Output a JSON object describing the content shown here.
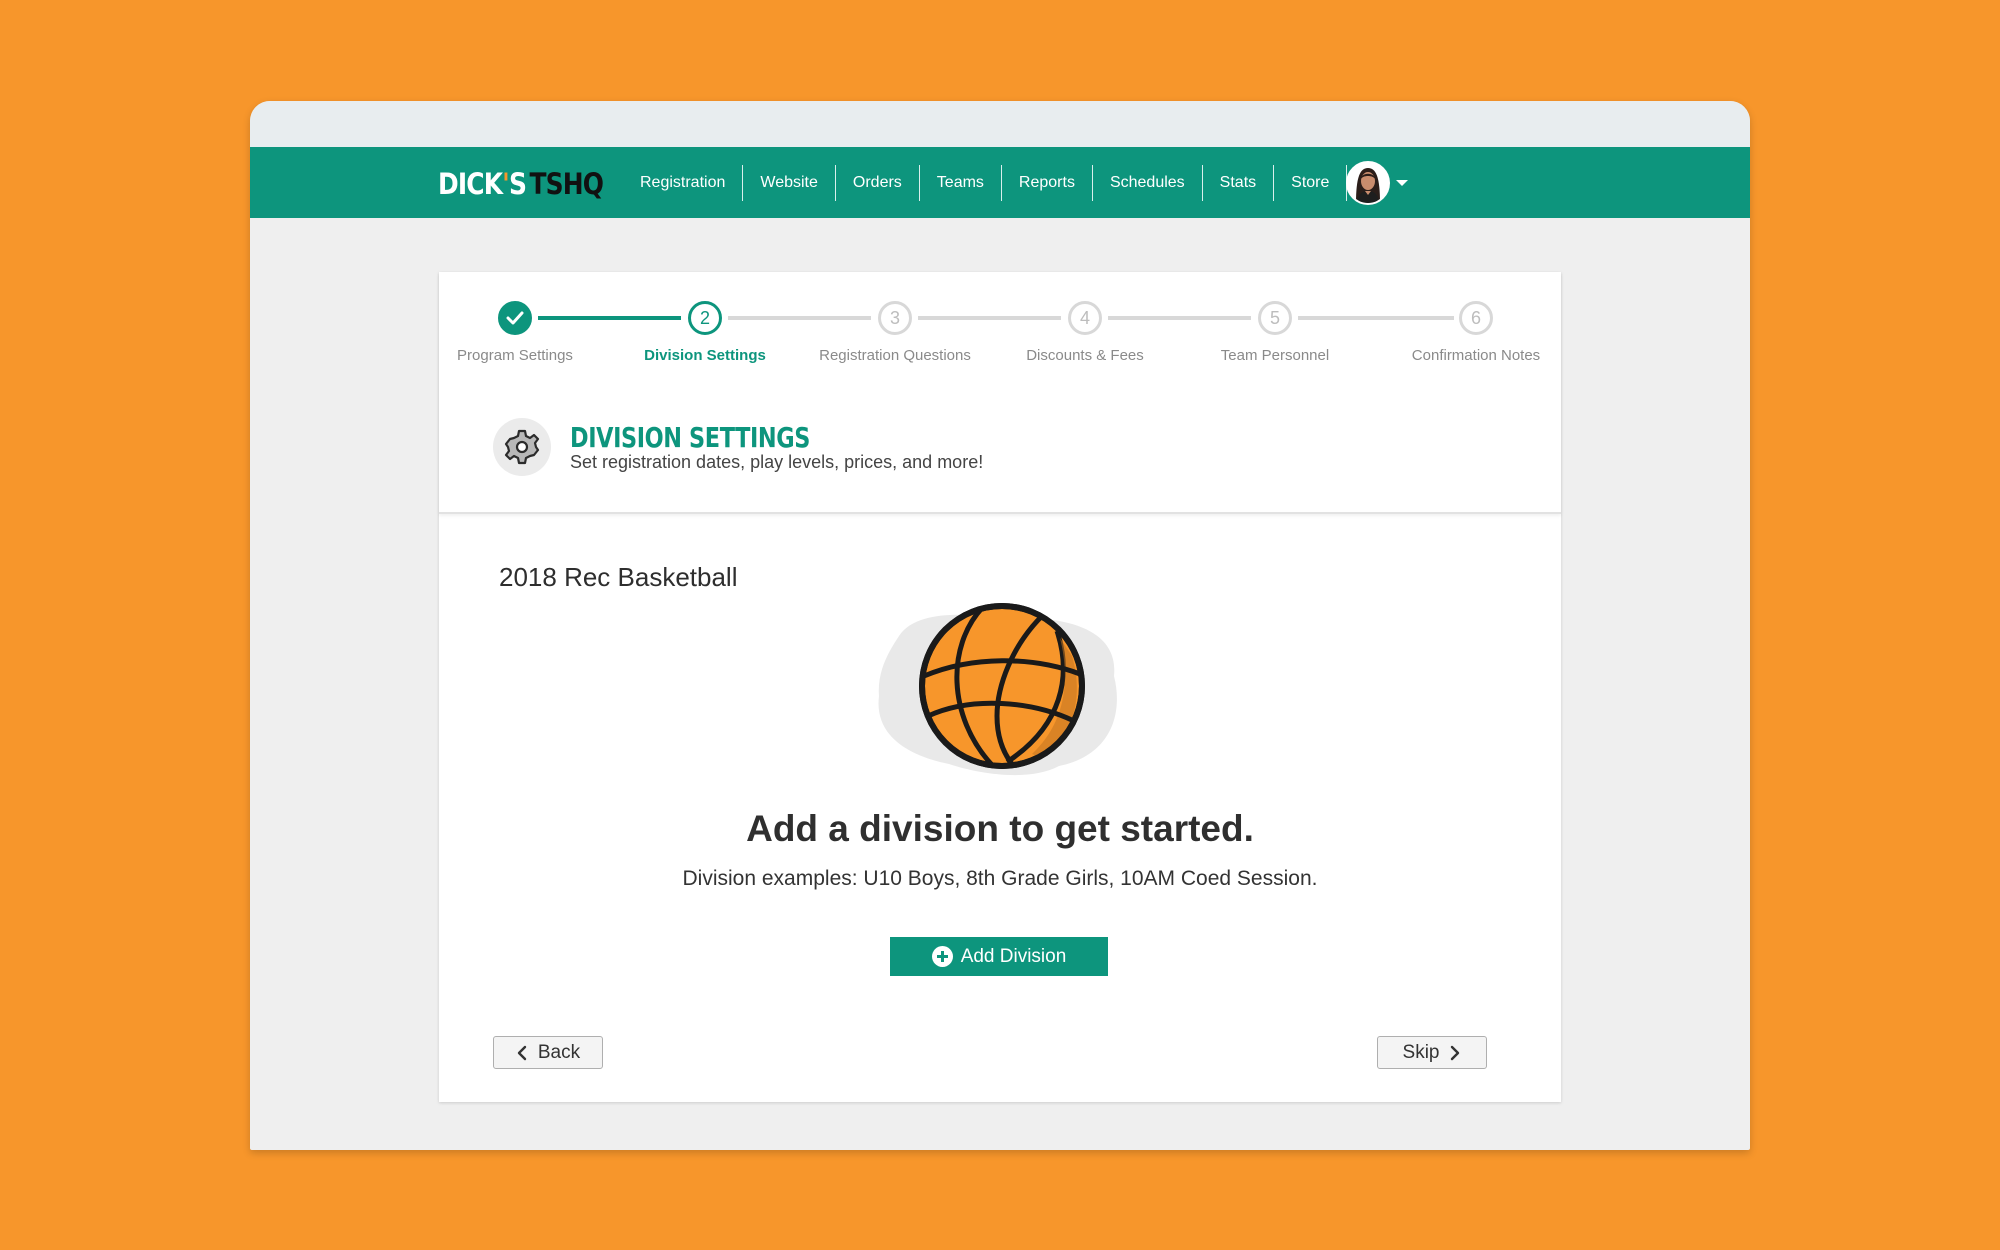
{
  "brand": {
    "logo_part1": "DICK",
    "logo_apostrophe": "'",
    "logo_part2": "S",
    "logo_part3": "TSHQ"
  },
  "nav": {
    "items": [
      {
        "label": "Registration"
      },
      {
        "label": "Website"
      },
      {
        "label": "Orders"
      },
      {
        "label": "Teams"
      },
      {
        "label": "Reports"
      },
      {
        "label": "Schedules"
      },
      {
        "label": "Stats"
      },
      {
        "label": "Store"
      }
    ]
  },
  "stepper": {
    "steps": [
      {
        "number": "1",
        "label": "Program Settings",
        "state": "done"
      },
      {
        "number": "2",
        "label": "Division Settings",
        "state": "active"
      },
      {
        "number": "3",
        "label": "Registration Questions",
        "state": "todo"
      },
      {
        "number": "4",
        "label": "Discounts & Fees",
        "state": "todo"
      },
      {
        "number": "5",
        "label": "Team Personnel",
        "state": "todo"
      },
      {
        "number": "6",
        "label": "Confirmation Notes",
        "state": "todo"
      }
    ]
  },
  "section": {
    "title": "DIVISION SETTINGS",
    "subtitle": "Set registration dates, play levels, prices, and more!",
    "icon": "gear-icon"
  },
  "content": {
    "program_name": "2018 Rec Basketball",
    "illustration": "basketball-icon",
    "headline": "Add a division to get started.",
    "examples": "Division examples: U10 Boys, 8th Grade Girls, 10AM Coed Session.",
    "add_button_label": "Add Division"
  },
  "footer": {
    "back_label": "Back",
    "skip_label": "Skip"
  },
  "colors": {
    "brand_green": "#0D957D",
    "background_orange": "#F7962B",
    "ball_orange": "#F7962B"
  }
}
